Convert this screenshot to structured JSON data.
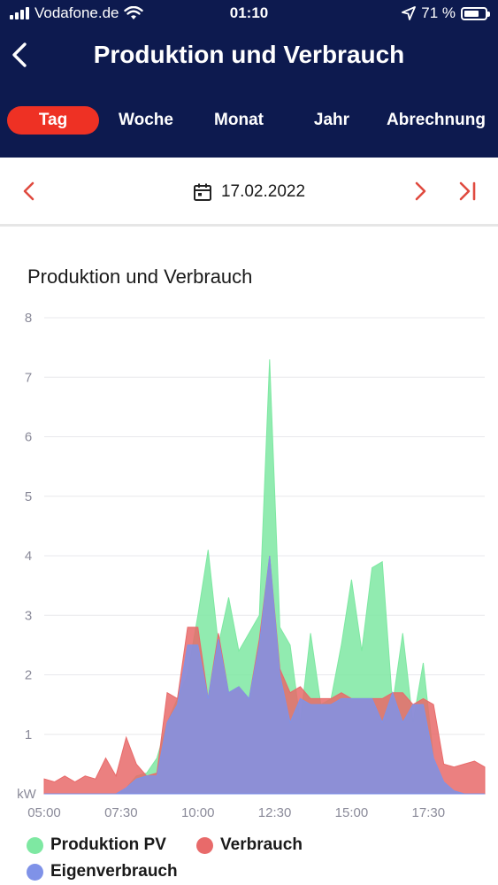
{
  "status_bar": {
    "carrier": "Vodafone.de",
    "time": "01:10",
    "battery": "71 %",
    "battery_level": 0.71
  },
  "header": {
    "title": "Produktion und Verbrauch"
  },
  "tabs": [
    {
      "label": "Tag",
      "active": true
    },
    {
      "label": "Woche",
      "active": false
    },
    {
      "label": "Monat",
      "active": false
    },
    {
      "label": "Jahr",
      "active": false
    },
    {
      "label": "Abrechnung",
      "active": false
    }
  ],
  "date_nav": {
    "date": "17.02.2022"
  },
  "colors": {
    "nav_background": "#0d1a4f",
    "accent": "#ee3124",
    "production": "#7ee8a2",
    "consumption": "#e86a6a",
    "self_consumption": "#7f92e8"
  },
  "chart_data": {
    "type": "area",
    "title": "Produktion und Verbrauch",
    "ylabel": "kW",
    "ylim": [
      0,
      8
    ],
    "yticks": [
      "1",
      "2",
      "3",
      "4",
      "5",
      "6",
      "7",
      "8"
    ],
    "xlim": [
      "05:00",
      "19:20"
    ],
    "xticks": [
      "05:00",
      "07:30",
      "10:00",
      "12:30",
      "15:00",
      "17:30"
    ],
    "grid": true,
    "legend_position": "bottom",
    "x": [
      "05:00",
      "05:20",
      "05:40",
      "06:00",
      "06:20",
      "06:40",
      "07:00",
      "07:20",
      "07:40",
      "08:00",
      "08:20",
      "08:40",
      "09:00",
      "09:20",
      "09:40",
      "10:00",
      "10:20",
      "10:40",
      "11:00",
      "11:20",
      "11:40",
      "12:00",
      "12:20",
      "12:40",
      "13:00",
      "13:20",
      "13:40",
      "14:00",
      "14:20",
      "14:40",
      "15:00",
      "15:20",
      "15:40",
      "16:00",
      "16:20",
      "16:40",
      "17:00",
      "17:20",
      "17:40",
      "18:00",
      "18:20",
      "18:40",
      "19:00",
      "19:20"
    ],
    "series": [
      {
        "name": "Produktion PV",
        "color": "#7ee8a2",
        "values": [
          0,
          0,
          0,
          0,
          0,
          0,
          0,
          0,
          0.1,
          0.3,
          0.35,
          0.6,
          1.2,
          1.6,
          2.0,
          3.0,
          4.1,
          2.5,
          3.3,
          2.4,
          2.7,
          3.0,
          7.3,
          2.8,
          2.5,
          1.2,
          2.7,
          1.5,
          1.6,
          2.5,
          3.6,
          2.4,
          3.8,
          3.9,
          1.5,
          2.7,
          1.2,
          2.2,
          0.6,
          0.2,
          0.05,
          0,
          0,
          0
        ]
      },
      {
        "name": "Verbrauch",
        "color": "#e86a6a",
        "values": [
          0.25,
          0.2,
          0.3,
          0.2,
          0.3,
          0.25,
          0.6,
          0.3,
          0.95,
          0.5,
          0.3,
          0.35,
          1.7,
          1.6,
          2.8,
          2.8,
          1.6,
          2.7,
          1.7,
          1.8,
          1.6,
          2.6,
          4.0,
          2.1,
          1.7,
          1.8,
          1.6,
          1.6,
          1.6,
          1.7,
          1.6,
          1.6,
          1.6,
          1.6,
          1.7,
          1.7,
          1.5,
          1.6,
          1.5,
          0.5,
          0.45,
          0.5,
          0.55,
          0.45
        ]
      },
      {
        "name": "Eigenverbrauch",
        "color": "#7f92e8",
        "values": [
          0,
          0,
          0,
          0,
          0,
          0,
          0,
          0,
          0.1,
          0.25,
          0.3,
          0.3,
          1.2,
          1.5,
          2.5,
          2.5,
          1.6,
          2.6,
          1.7,
          1.8,
          1.6,
          2.5,
          4.0,
          2.0,
          1.2,
          1.6,
          1.5,
          1.5,
          1.5,
          1.6,
          1.6,
          1.6,
          1.6,
          1.2,
          1.7,
          1.2,
          1.5,
          1.5,
          0.6,
          0.2,
          0.05,
          0,
          0,
          0
        ]
      }
    ]
  }
}
